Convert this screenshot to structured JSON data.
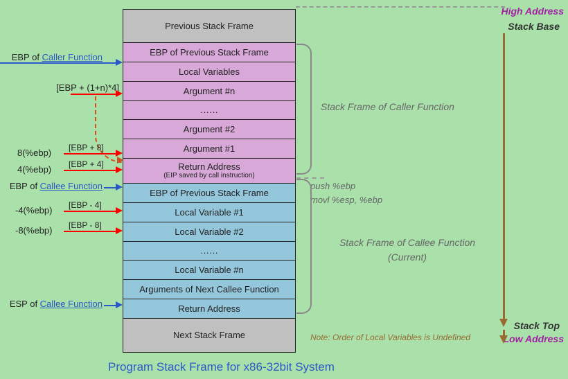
{
  "cells": {
    "prev_frame": "Previous Stack Frame",
    "ebp_prev1": "EBP of Previous Stack Frame",
    "locals_caller": "Local Variables",
    "arg_n": "Argument #n",
    "dots1": "……",
    "arg_2": "Argument #2",
    "arg_1": "Argument #1",
    "ret_addr": "Return Address",
    "ret_addr_sub": "(EIP saved by call instruction)",
    "ebp_prev2": "EBP of Previous Stack Frame",
    "lv1": "Local Variable #1",
    "lv2": "Local Variable #2",
    "dots2": "……",
    "lvn": "Local Variable #n",
    "args_next": "Arguments of Next Callee Function",
    "ret_addr2": "Return Address",
    "next_frame": "Next Stack Frame"
  },
  "left": {
    "ebp_caller_pre": "EBP of ",
    "ebp_caller_un": "Caller Function",
    "ebp_plus_n": "[EBP + (1+n)*4]",
    "off_8": "8(%ebp)",
    "off_8_b": "[EBP + 8]",
    "off_4": "4(%ebp)",
    "off_4_b": "[EBP + 4]",
    "ebp_callee_pre": "EBP of ",
    "ebp_callee_un": "Callee Function",
    "off_m4": "-4(%ebp)",
    "off_m4_b": "[EBP - 4]",
    "off_m8": "-8(%ebp)",
    "off_m8_b": "[EBP - 8]",
    "esp_callee_pre": "ESP of ",
    "esp_callee_un": "Callee Function"
  },
  "right": {
    "high_addr": "High Address",
    "stack_base": "Stack Base",
    "caller_frame": "Stack Frame of Caller Function",
    "asm1": "push %ebp",
    "asm2": "movl  %esp, %ebp",
    "callee_frame": "Stack Frame of Callee Function",
    "current": "(Current)",
    "stack_top": "Stack Top",
    "low_addr": "Low Address"
  },
  "note": "Note: Order of Local Variables is Undefined",
  "title": "Program Stack Frame for x86-32bit System"
}
